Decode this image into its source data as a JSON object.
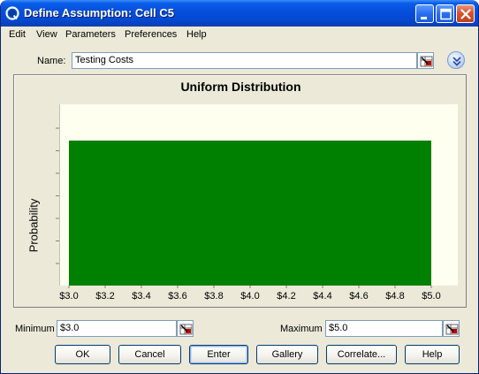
{
  "window": {
    "title": "Define Assumption: Cell C5"
  },
  "menu": {
    "items": [
      "Edit",
      "View",
      "Parameters",
      "Preferences",
      "Help"
    ]
  },
  "name_field": {
    "label": "Name:",
    "value": "Testing Costs"
  },
  "chart_data": {
    "type": "bar",
    "title": "Uniform Distribution",
    "ylabel": "Probability",
    "xlabel": "",
    "x_ticks": [
      "$3.0",
      "$3.2",
      "$3.4",
      "$3.6",
      "$3.8",
      "$4.0",
      "$4.2",
      "$4.4",
      "$4.6",
      "$4.8",
      "$5.0"
    ],
    "xlim": [
      3.0,
      5.0
    ],
    "y_ticks_shown": false,
    "y_tick_count": 7,
    "distribution": {
      "name": "Uniform",
      "min": 3.0,
      "max": 5.0,
      "relative_height": 0.8
    },
    "bar_color": "#008000",
    "plot_background": "#fffff0"
  },
  "params": {
    "minimum_label": "Minimum",
    "minimum_value": "$3.0",
    "maximum_label": "Maximum",
    "maximum_value": "$5.0"
  },
  "buttons": {
    "ok": "OK",
    "cancel": "Cancel",
    "enter": "Enter",
    "gallery": "Gallery",
    "correlate": "Correlate...",
    "help": "Help"
  },
  "colors": {
    "titlebar": "#0550dc",
    "dialog_bg": "#ece9d8",
    "close_button": "#d9532d"
  }
}
